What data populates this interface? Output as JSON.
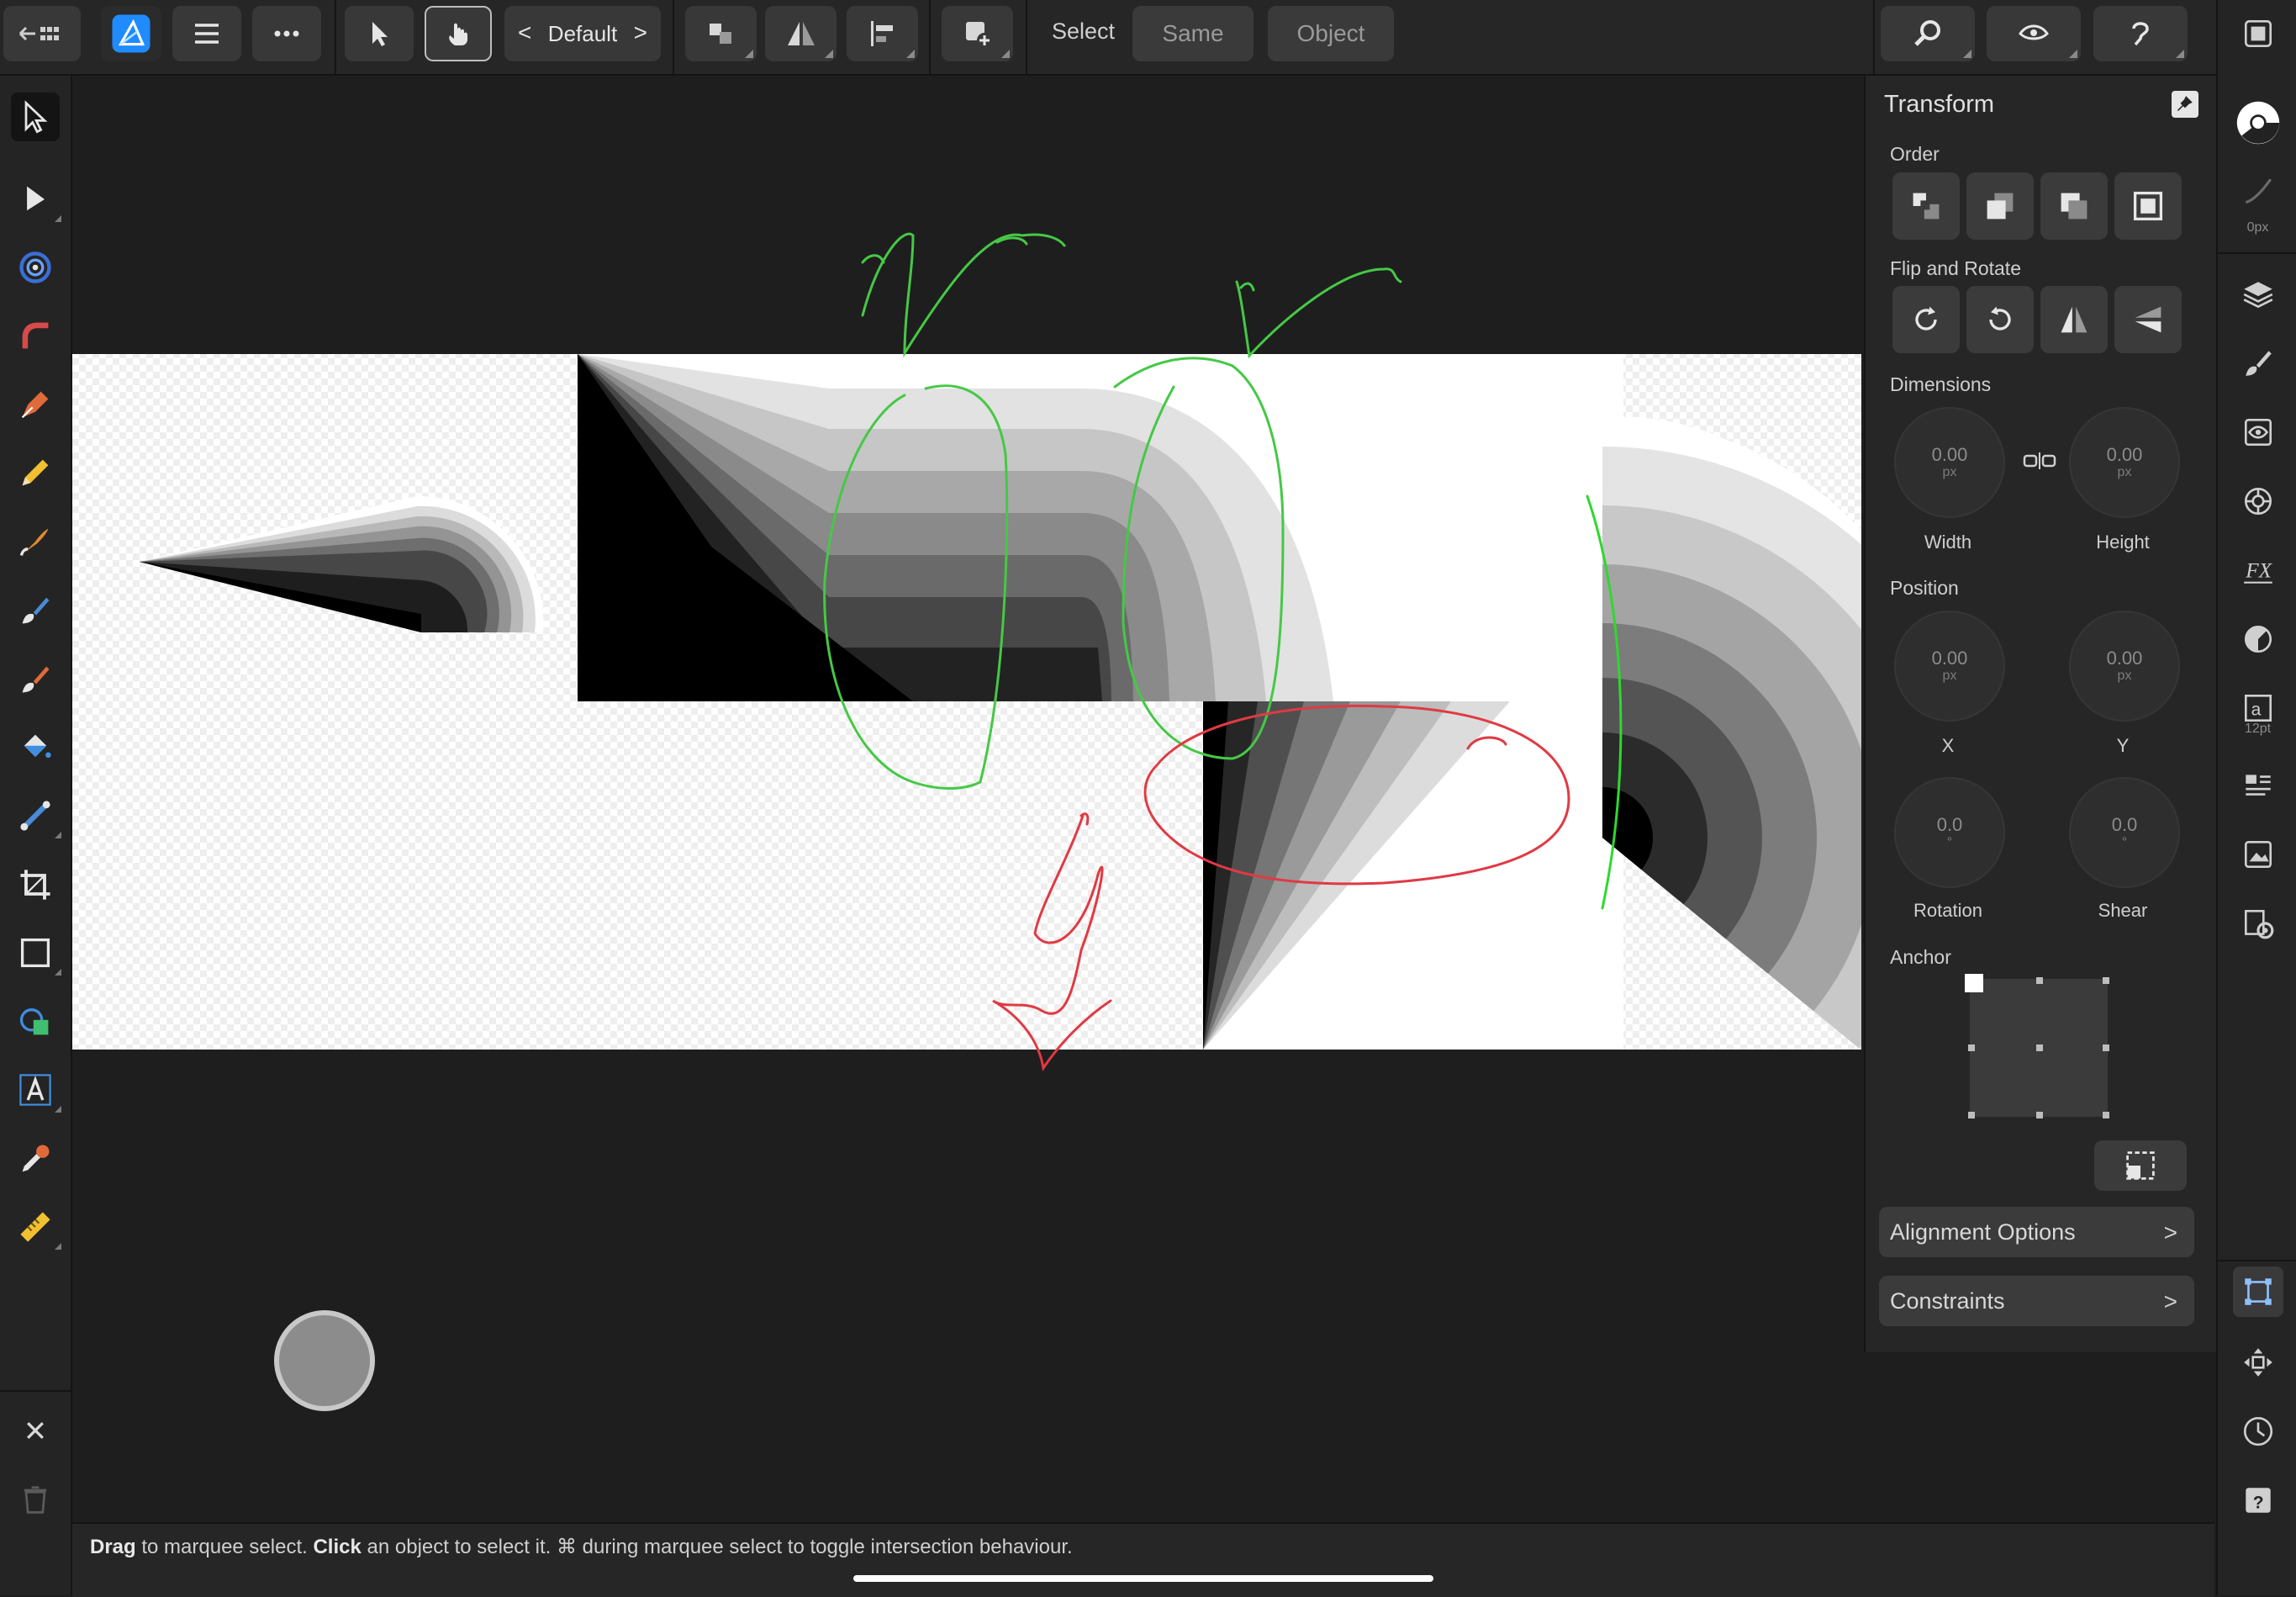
{
  "toolbar": {
    "persona": "Default",
    "select_label": "Select",
    "same_label": "Same",
    "object_label": "Object"
  },
  "panel": {
    "title": "Transform",
    "order_label": "Order",
    "flip_label": "Flip and Rotate",
    "dimensions_label": "Dimensions",
    "width": {
      "value": "0.00",
      "unit": "px",
      "label": "Width"
    },
    "height": {
      "value": "0.00",
      "unit": "px",
      "label": "Height"
    },
    "position_label": "Position",
    "x": {
      "value": "0.00",
      "unit": "px",
      "label": "X"
    },
    "y": {
      "value": "0.00",
      "unit": "px",
      "label": "Y"
    },
    "rotation": {
      "value": "0.0",
      "unit": "°",
      "label": "Rotation"
    },
    "shear": {
      "value": "0.0",
      "unit": "°",
      "label": "Shear"
    },
    "anchor_label": "Anchor",
    "alignment_options": "Alignment Options",
    "constraints": "Constraints"
  },
  "right_strip": {
    "stroke_width": "0px",
    "text_size": "12pt"
  },
  "status": {
    "part1": "Drag",
    "part2": " to marquee select. ",
    "part3": "Click",
    "part4": " an object to select it. ⌘ during marquee select to toggle intersection behaviour."
  },
  "colors": {
    "background": "#1e1e1e",
    "panel": "#262626",
    "accent_blue": "#2c7fe6",
    "annotation_green": "#3ec43e",
    "annotation_red": "#e0303a"
  },
  "icons": {
    "app": "affinity-designer-icon",
    "canvas_shapes": [
      "cone-gradient",
      "corner-bands",
      "fan-arc"
    ]
  }
}
